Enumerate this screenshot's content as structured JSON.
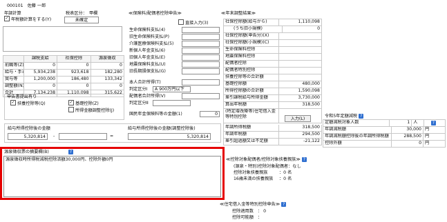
{
  "employee": {
    "id": "000101",
    "name": "佐藤 一郎"
  },
  "year_end": {
    "label": "年調計算",
    "checkbox_label": "年税額計算をする(Y)",
    "checked": true,
    "tax_class_label": "税表区分：",
    "tax_class": "甲欄",
    "status": "未確定"
  },
  "income_table": {
    "headers": [
      "",
      "課税支給",
      "社保控除",
      "源泉徴収"
    ],
    "rows": [
      [
        "前職等(Z)",
        "0",
        "0",
        "0"
      ],
      [
        "給与・手当",
        "5,934,238",
        "923,618",
        "182,280"
      ],
      [
        "賞与等",
        "1,200,000",
        "186,480",
        "133,342"
      ],
      [
        "調整額(N)",
        "0",
        "0",
        "0"
      ],
      [
        "合計",
        "7,134,238",
        "1,110,098",
        "315,622"
      ]
    ]
  },
  "declaration": {
    "title": "申告書提出有り",
    "items": [
      {
        "label": "扶養控除等(Q)",
        "checked": true
      },
      {
        "label": "基礎控除(Z)",
        "checked": true
      },
      {
        "label": "所得金額調整控除(J)",
        "checked": false
      }
    ]
  },
  "adjusted_income": {
    "left_label": "給与所得控除後の金額",
    "left_value": "5,320,814",
    "right_label": "給与所得控除後の金額(調整控除後)",
    "right_value": "5,320,814",
    "minus": "-",
    "equals": "="
  },
  "insurance": {
    "title": "≪保険料/配偶者控除申告≫",
    "direct_input": "直接入力(3)",
    "items": [
      "生命保険料支払(4)",
      "旧生命保険料支払(P)",
      "介護医療保険料支払(5)",
      "新個人年金支払(6)",
      "旧個人年金支払(E)",
      "地震保険料支払(U)",
      "旧長期損保支払(G)"
    ],
    "spouse_income_label": "本人合計所得(T)",
    "spouse_class_label": "判定区分Ⅰ",
    "spouse_class_value": "A 900万円以下",
    "spouse_total_label": "配偶者合計所得(V)",
    "spouse_class2_label": "判定区分Ⅱ",
    "pension_label": "国民年金保険料等の金額(1)",
    "pension_value": "0"
  },
  "result": {
    "title": "≪年末調整結果≫",
    "rows": [
      {
        "label": "社保控除額(給与から)",
        "value": "1,110,098"
      },
      {
        "label": "(うち旧小規模)",
        "value": "0"
      },
      {
        "label": "社保控除額(申告分)(X)",
        "value": ""
      },
      {
        "label": "社保控除額(小規模)(C)",
        "value": ""
      },
      {
        "label": "生命保険料控除",
        "value": ""
      },
      {
        "label": "地震保険料控除",
        "value": ""
      },
      {
        "label": "配偶者控除",
        "value": ""
      },
      {
        "label": "配偶者特別控除",
        "value": ""
      },
      {
        "label": "扶養控除等の合計額",
        "value": ""
      },
      {
        "label": "基礎控除額",
        "value": "480,000"
      },
      {
        "label": "所得控除額の合計額",
        "value": "1,590,098"
      },
      {
        "label": "差引課税給与所得金額",
        "value": "3,730,000"
      },
      {
        "label": "算出年税額",
        "value": "318,500"
      }
    ],
    "housing_label": "(特定增改築等)住宅借入金等特別控除",
    "housing_btn": "入力(L)",
    "bottom_rows": [
      {
        "label": "年調所得税額",
        "value": "318,500"
      },
      {
        "label": "年調年税額",
        "value": "294,500"
      },
      {
        "label": "差引超過額又は不足額",
        "value": "-21,122"
      }
    ]
  },
  "reiwa": {
    "title": "令和5年定額減税",
    "rows": [
      {
        "label": "定額減税対象人数",
        "value": "1",
        "unit": "人"
      },
      {
        "label": "年調減税額",
        "value": "30,000",
        "unit": "円"
      },
      {
        "label": "年調減税額控除後の年調所得税額",
        "value": "288,500",
        "unit": "円"
      },
      {
        "label": "控除外額",
        "value": "0",
        "unit": "円"
      }
    ]
  },
  "remarks": {
    "title": "源泉徴収票の摘要欄(B)",
    "text": "源泉徴収時所得税減税控除済額30,000円、控除外額0円"
  },
  "dependents": {
    "title": "≪控除対象配偶者/控除対象扶養親族≫",
    "lines": [
      {
        "label": "(源泉・特別)控除対象配偶者：",
        "value": "なし"
      },
      {
        "label": "控除対象扶養親族",
        "value": "：0 名"
      },
      {
        "label": "16歳未満の扶養親族",
        "value": "：0 名"
      }
    ]
  },
  "housing_loan": {
    "title": "≪住宅借入金等特別控除申告≫",
    "lines": [
      {
        "label": "控除適用数",
        "value": "： 0"
      },
      {
        "label": "控除可能額",
        "value": "："
      }
    ]
  },
  "colors": {
    "red": "#e50000",
    "help": "#2f6fd0"
  }
}
